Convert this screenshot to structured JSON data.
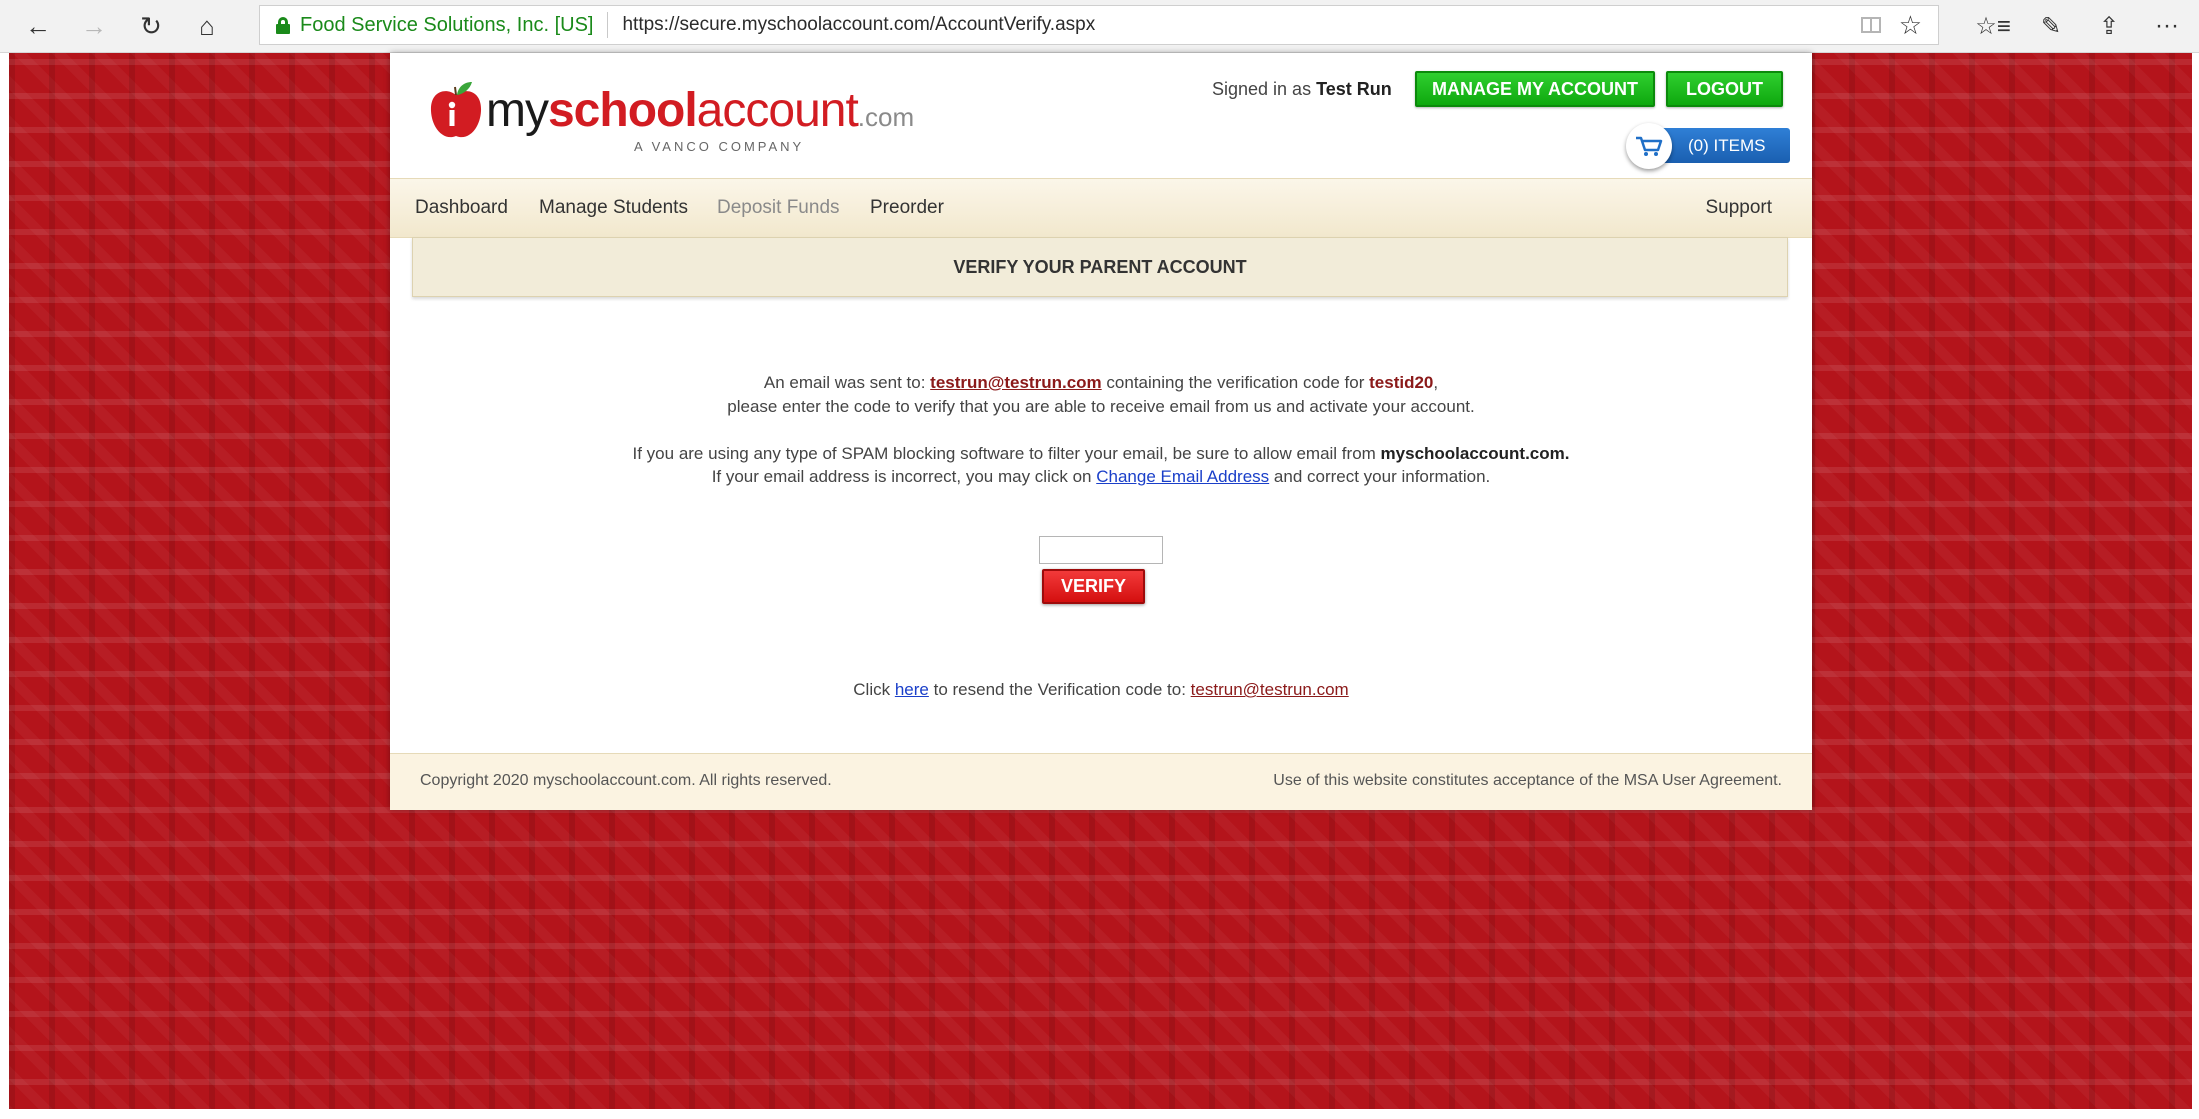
{
  "browser": {
    "site_identity": "Food Service Solutions, Inc. [US]",
    "url": "https://secure.myschoolaccount.com/AccountVerify.aspx",
    "nav_icons": {
      "back": "←",
      "forward": "→",
      "refresh": "↻",
      "home": "⌂"
    },
    "tool_icons": {
      "favorites": "☆",
      "favorites_list": "☆≡",
      "pen": "✎",
      "share": "⇪",
      "more": "···"
    }
  },
  "header": {
    "logo": {
      "word1": "my",
      "word2": "school",
      "word3": "account",
      "word4": ".com",
      "tagline": "A VANCO COMPANY"
    },
    "signed_in_prefix": "Signed in as",
    "user_name": "Test Run",
    "manage_button": "MANAGE MY ACCOUNT",
    "logout_button": "LOGOUT",
    "cart_label": "(0) ITEMS"
  },
  "menu": {
    "items": [
      "Dashboard",
      "Manage Students",
      "Deposit Funds",
      "Preorder"
    ],
    "support": "Support"
  },
  "section_title": "VERIFY YOUR PARENT ACCOUNT",
  "message": {
    "line1_a": "An email was sent to:",
    "email": "testrun@testrun.com",
    "line1_b": "containing the verification code for",
    "user_id": "testid20",
    "line1_c": ",",
    "line2": "please enter the code to verify that you are able to receive email from us and activate your account.",
    "line3_a": "If you are using any type of SPAM blocking software to filter your email, be sure to allow email from",
    "line3_domain": "myschoolaccount.com.",
    "line4_a": "If your email address is incorrect, you may click on",
    "line4_link": "Change Email Address",
    "line4_b": "and correct your information."
  },
  "verify": {
    "code_value": "",
    "button": "VERIFY"
  },
  "resend": {
    "prefix": "Click",
    "link": "here",
    "middle": "to resend the Verification code to:",
    "email": "testrun@testrun.com"
  },
  "footer": {
    "copyright": "Copyright 2020 myschoolaccount.com. All rights reserved.",
    "agreement": "Use of this website constitutes acceptance of the MSA User Agreement."
  },
  "colors": {
    "brand_red": "#d21c22",
    "button_green": "#1bb81b",
    "cart_blue": "#1f6fc7",
    "background_red": "#b4141b"
  }
}
